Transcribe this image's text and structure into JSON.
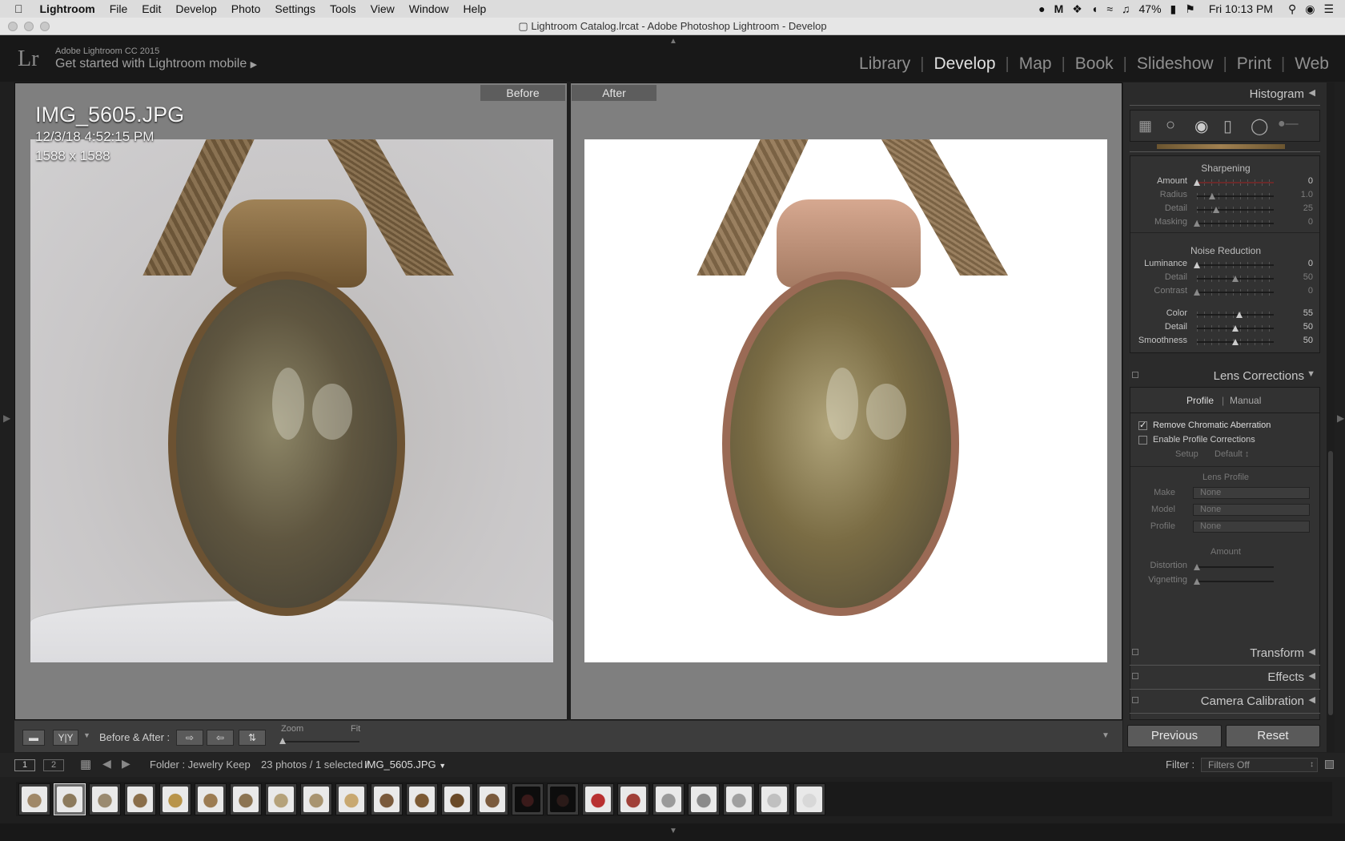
{
  "menubar": {
    "app": "Lightroom",
    "items": [
      "File",
      "Edit",
      "Develop",
      "Photo",
      "Settings",
      "Tools",
      "View",
      "Window",
      "Help"
    ],
    "battery": "47%",
    "clock": "Fri 10:13 PM"
  },
  "window": {
    "title": "Lightroom Catalog.lrcat - Adobe Photoshop Lightroom - Develop"
  },
  "identity": {
    "small": "Adobe Lightroom CC 2015",
    "big": "Get started with Lightroom mobile",
    "logo": "Lr",
    "modules": [
      "Library",
      "Develop",
      "Map",
      "Book",
      "Slideshow",
      "Print",
      "Web"
    ],
    "active_module": "Develop"
  },
  "view": {
    "before_label": "Before",
    "after_label": "After",
    "filename": "IMG_5605.JPG",
    "datetime": "12/3/18 4:52:15 PM",
    "dimensions": "1588 x 1588"
  },
  "toolbar": {
    "before_after_label": "Before & After :",
    "zoom_label": "Zoom",
    "fit_label": "Fit",
    "yy_label": "Y|Y"
  },
  "panel": {
    "histogram": "Histogram",
    "sharpening": {
      "title": "Sharpening",
      "rows": [
        {
          "label": "Amount",
          "value": "0",
          "pos": 0
        },
        {
          "label": "Radius",
          "value": "1.0",
          "pos": 0.2
        },
        {
          "label": "Detail",
          "value": "25",
          "pos": 0.25
        },
        {
          "label": "Masking",
          "value": "0",
          "pos": 0
        }
      ]
    },
    "noise": {
      "title": "Noise Reduction",
      "rows": [
        {
          "label": "Luminance",
          "value": "0",
          "pos": 0
        },
        {
          "label": "Detail",
          "value": "50",
          "pos": 0.5
        },
        {
          "label": "Contrast",
          "value": "0",
          "pos": 0
        },
        {
          "label": "Color",
          "value": "55",
          "pos": 0.55
        },
        {
          "label": "Detail",
          "value": "50",
          "pos": 0.5
        },
        {
          "label": "Smoothness",
          "value": "50",
          "pos": 0.5
        }
      ]
    },
    "lens": {
      "title": "Lens Corrections",
      "tab_profile": "Profile",
      "tab_manual": "Manual",
      "remove_ca": "Remove Chromatic Aberration",
      "enable_profile": "Enable Profile Corrections",
      "setup_label": "Setup",
      "setup_value": "Default",
      "lens_profile": "Lens Profile",
      "make_label": "Make",
      "model_label": "Model",
      "profile_label": "Profile",
      "none": "None",
      "amount": "Amount",
      "distortion": "Distortion",
      "vignetting": "Vignetting"
    },
    "transform": "Transform",
    "effects": "Effects",
    "calibration": "Camera Calibration",
    "previous": "Previous",
    "reset": "Reset"
  },
  "filmbar": {
    "page1": "1",
    "page2": "2",
    "folder": "Folder : Jewelry Keep",
    "count": "23 photos / 1 selected /",
    "selected": "IMG_5605.JPG",
    "filter_label": "Filter :",
    "filter_value": "Filters Off"
  },
  "thumbs": [
    "#a08868",
    "#8c7a5c",
    "#9a8a70",
    "#8a6e4a",
    "#b8944a",
    "#9c7c52",
    "#8c7452",
    "#b5a27a",
    "#a89470",
    "#c8a870",
    "#7a5a3c",
    "#7c5a34",
    "#6a4a28",
    "#7a5a3c",
    "#3a1a1a",
    "#2a1a18",
    "#b83030",
    "#a04038",
    "#9a9a9a",
    "#8a8a8a",
    "#a0a0a0",
    "#c0c0c0",
    "#d8d8d8"
  ]
}
